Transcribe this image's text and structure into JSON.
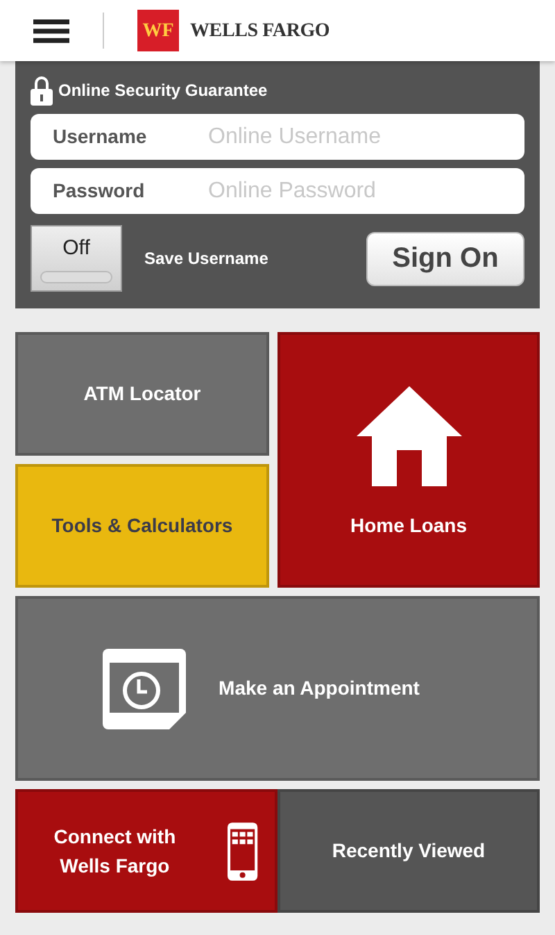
{
  "header": {
    "logo_mark": "WF",
    "logo_name": "WELLS FARGO"
  },
  "login": {
    "security_label": "Online Security Guarantee",
    "fields": [
      {
        "label": "Username",
        "placeholder": "Online Username"
      },
      {
        "label": "Password",
        "placeholder": "Online Password"
      }
    ],
    "save_username": {
      "toggle_text": "Off",
      "on": false,
      "label": "Save Username"
    },
    "sign_on": "Sign On"
  },
  "tiles": [
    {
      "label": "ATM Locator",
      "color": "#6e6e6e",
      "kind": "plain"
    },
    {
      "label": "Home Loans",
      "color": "#a80d0f",
      "kind": "house"
    },
    {
      "label": "Tools & Calculators",
      "color": "#e9b80f",
      "kind": "plain"
    },
    {
      "label": "Make an Appointment",
      "color": "#6e6e6e",
      "kind": "appointment"
    },
    {
      "label": "Connect with Wells Fargo",
      "color": "#a80d0f",
      "kind": "phone"
    },
    {
      "label": "Recently Viewed",
      "color": "#555555",
      "kind": "plain"
    }
  ]
}
